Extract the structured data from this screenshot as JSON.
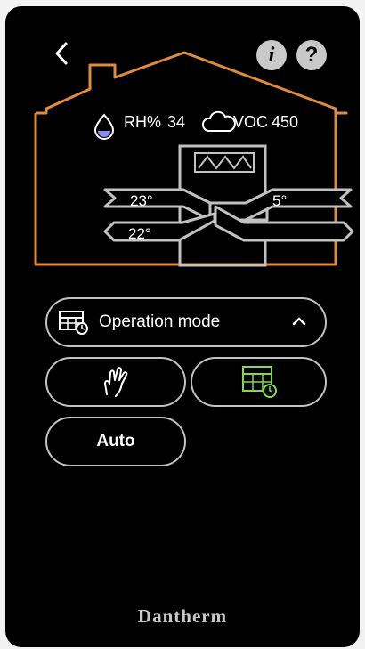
{
  "nav": {
    "back_icon": "chevron-left-icon",
    "info_label": "i",
    "help_label": "?"
  },
  "status": {
    "humidity_label": "RH%",
    "humidity_value": "34",
    "voc_label": "VOC",
    "voc_value": "450",
    "humidity_icon": "water-drop-icon",
    "voc_icon": "cloud-icon"
  },
  "airflow": {
    "supply_in_temp": "23°",
    "outdoor_temp": "5°",
    "extract_temp": "22°"
  },
  "mode": {
    "label": "Operation mode",
    "manual_icon": "hand-icon",
    "schedule_icon": "calendar-clock-icon",
    "auto_label": "Auto",
    "active_color": "#7ed957"
  },
  "brand": "Dantherm",
  "colors": {
    "house_outline": "#e08b3a",
    "unit_outline": "#c2c2c2",
    "background": "#000000"
  }
}
